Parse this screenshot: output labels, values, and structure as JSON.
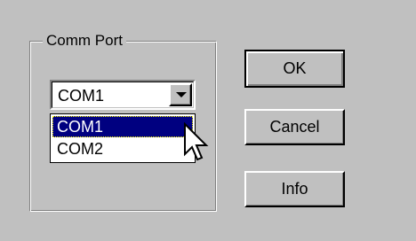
{
  "groupbox": {
    "label": "Comm Port"
  },
  "combo": {
    "selected_value": "COM1",
    "options": [
      "COM1",
      "COM2"
    ],
    "highlighted_index": 0,
    "arrow_icon": "triangle-down-icon"
  },
  "buttons": {
    "ok_label": "OK",
    "cancel_label": "Cancel",
    "info_label": "Info"
  },
  "colors": {
    "face": "#c0c0c0",
    "highlight": "#000080"
  }
}
